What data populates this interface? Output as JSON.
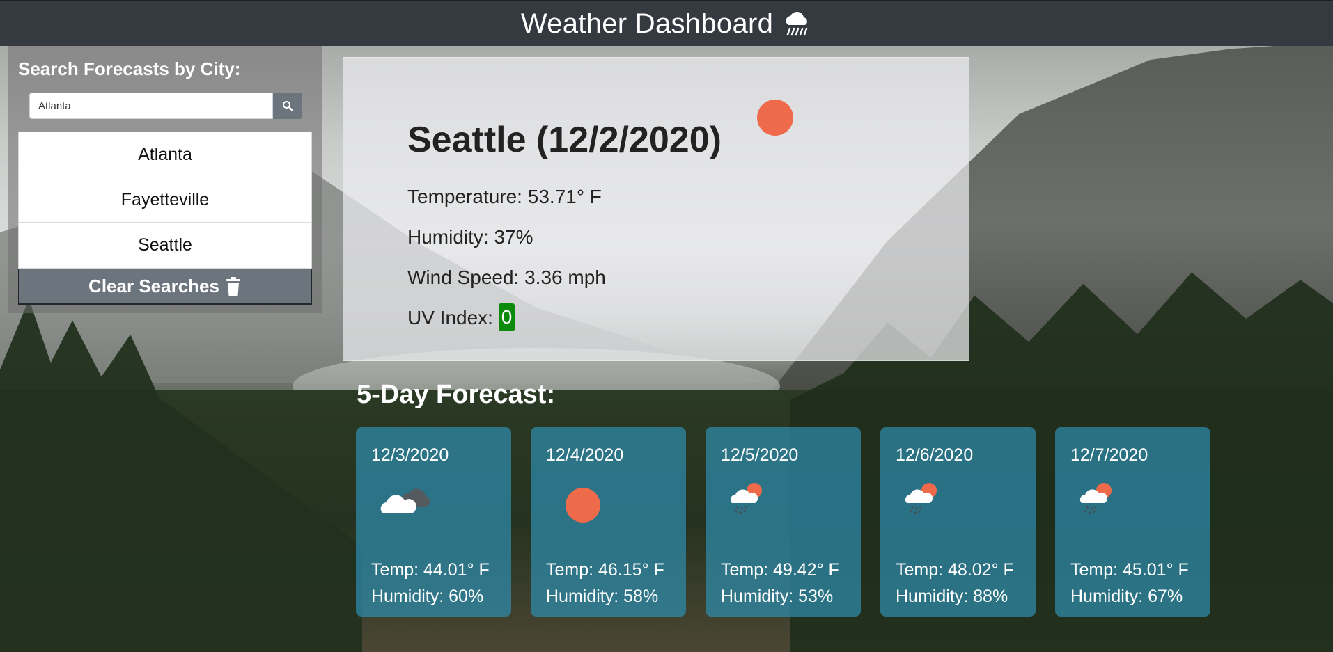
{
  "navbar": {
    "title": "Weather Dashboard",
    "icon": "cloud-rain-icon"
  },
  "sidebar": {
    "heading": "Search Forecasts by City:",
    "search": {
      "value": "Atlanta",
      "button_icon": "search-icon"
    },
    "history": [
      "Atlanta",
      "Fayetteville",
      "Seattle"
    ],
    "clear_label": "Clear Searches",
    "clear_icon": "trash-icon"
  },
  "current": {
    "title": "Seattle (12/2/2020)",
    "icon": "sun-icon",
    "temperature": "Temperature: 53.71° F",
    "humidity": "Humidity: 37%",
    "wind": "Wind Speed: 3.36 mph",
    "uv_label": "UV Index:",
    "uv_value": "0",
    "uv_color": "#0c8a0c"
  },
  "forecast": {
    "title": "5-Day Forecast:",
    "days": [
      {
        "date": "12/3/2020",
        "icon": "cloudy-icon",
        "temp": "Temp: 44.01° F",
        "humidity": "Humidity: 60%"
      },
      {
        "date": "12/4/2020",
        "icon": "sun-icon",
        "temp": "Temp: 46.15° F",
        "humidity": "Humidity: 58%"
      },
      {
        "date": "12/5/2020",
        "icon": "sun-rain-icon",
        "temp": "Temp: 49.42° F",
        "humidity": "Humidity: 53%"
      },
      {
        "date": "12/6/2020",
        "icon": "sun-rain-icon",
        "temp": "Temp: 48.02° F",
        "humidity": "Humidity: 88%"
      },
      {
        "date": "12/7/2020",
        "icon": "sun-rain-icon",
        "temp": "Temp: 45.01° F",
        "humidity": "Humidity: 67%"
      }
    ]
  },
  "colors": {
    "accent_sun": "#ef6a4b",
    "card_bg": "#2e8cad",
    "navbar_bg": "#343a40"
  }
}
